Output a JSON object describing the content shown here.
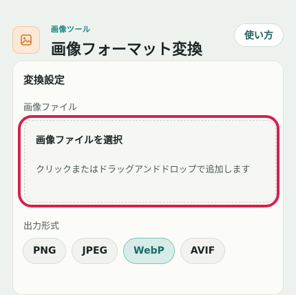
{
  "header": {
    "eyebrow": "画像ツール",
    "title": "画像フォーマット変換",
    "help_label": "使い方",
    "icon": "image-icon"
  },
  "settings": {
    "title": "変換設定",
    "file_label": "画像ファイル",
    "drop_title": "画像ファイルを選択",
    "drop_hint": "クリックまたはドラッグアンドドロップで追加します",
    "format_label": "出力形式",
    "formats": [
      "PNG",
      "JPEG",
      "WebP",
      "AVIF"
    ],
    "selected_format": "WebP"
  },
  "colors": {
    "accent": "#17877c",
    "highlight": "#d6204c",
    "selected_chip_bg": "#d7ece8"
  }
}
